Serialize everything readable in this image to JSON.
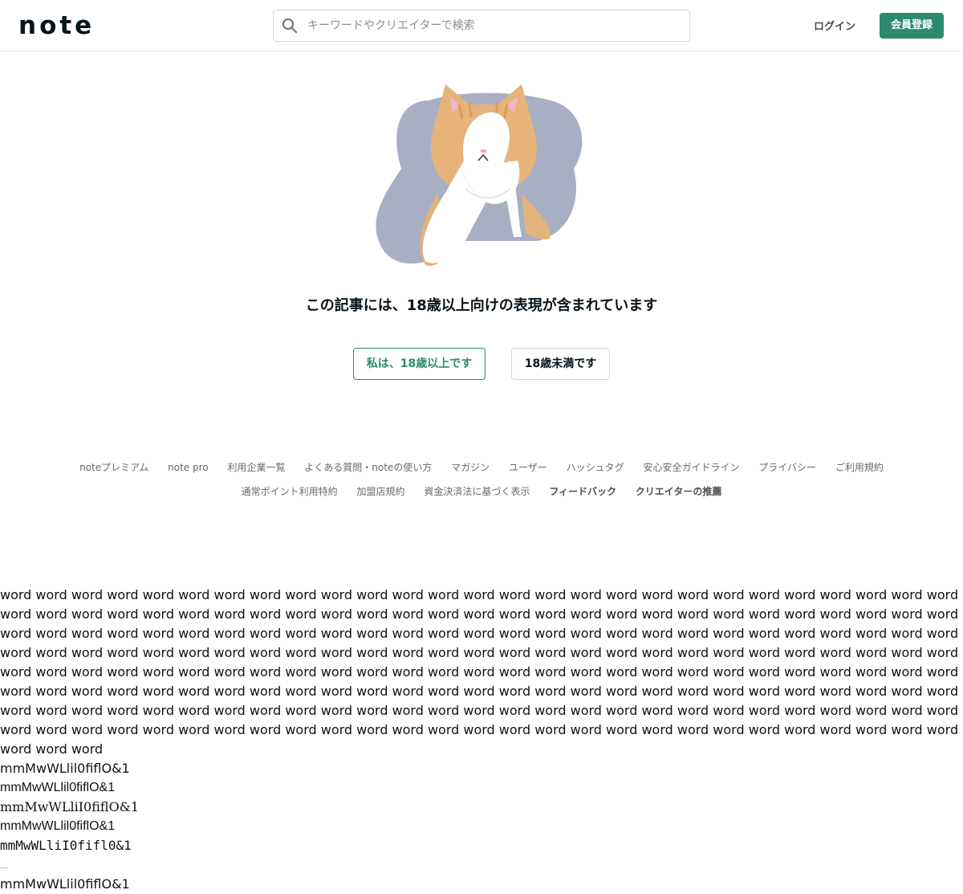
{
  "header": {
    "logo_text": "note",
    "search_placeholder": "キーワードやクリエイターで検索",
    "login_label": "ログイン",
    "signup_label": "会員登録"
  },
  "main": {
    "warning_text": "この記事には、18歳以上向けの表現が含まれています",
    "adult_button": "私は、18歳以上です",
    "minor_button": "18歳未満です"
  },
  "footer": {
    "row1": [
      "noteプレミアム",
      "note pro",
      "利用企業一覧",
      "よくある質問・noteの使い方",
      "マガジン",
      "ユーザー",
      "ハッシュタグ",
      "安心安全ガイドライン",
      "プライバシー",
      "ご利用規約"
    ],
    "row2": [
      "通常ポイント利用特約",
      "加盟店規約",
      "資金決済法に基づく表示",
      "フィードバック",
      "クリエイターの推薦"
    ]
  },
  "filler": {
    "word": "word",
    "word_count": 219
  },
  "font_samples": [
    "mmMwWLlil0fiflO&1",
    "mmMwWLlil0fiflO&1",
    "mmMwWLliI0fiflO&1",
    "mmMwWLlil0fiflO&1",
    "mmMwWLliI0fifl0&1"
  ],
  "last_sample": "mmMwWLlil0fiflO&1",
  "colors": {
    "brand_green": "#2c8a6e",
    "text": "#08131a",
    "cat_bg": "#a8afc3"
  }
}
